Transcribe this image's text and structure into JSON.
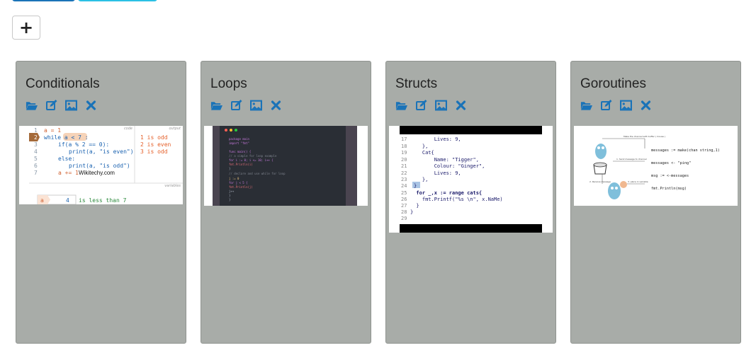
{
  "toolbar": {
    "add_label": "+"
  },
  "accent": "#1a73b8",
  "cards": [
    {
      "title": "Conditionals",
      "actions": [
        "folder-open-icon",
        "edit-icon",
        "image-icon",
        "close-icon"
      ],
      "thumb": {
        "header_code": "code",
        "header_output": "output",
        "code_lines": [
          {
            "n": "1",
            "t": "a = 1"
          },
          {
            "n": "2",
            "t": "while a < 7 :"
          },
          {
            "n": "3",
            "t": "if(a % 2 == 0):"
          },
          {
            "n": "4",
            "t": "print(a, \"is even\")"
          },
          {
            "n": "5",
            "t": "else:"
          },
          {
            "n": "6",
            "t": "print(a, \"is odd\")"
          },
          {
            "n": "7",
            "t": "a += 1"
          }
        ],
        "output_lines": [
          "1 is odd",
          "2 is even",
          "3 is odd"
        ],
        "watermark": "Wikitechy.com",
        "variables_label": "variables",
        "var_name": "a",
        "var_value": "4",
        "var_note": "is less than 7"
      }
    },
    {
      "title": "Loops",
      "actions": [
        "folder-open-icon",
        "edit-icon",
        "image-icon",
        "close-icon"
      ],
      "thumb": {
        "code_lines": [
          "package main",
          "import \"fmt\"",
          "",
          "func main() {",
          "  // a simple for loop example",
          "  for i := 0; i <= 10; i++ {",
          "    fmt.Println(i)",
          "  }",
          "  // declare and use while for loop",
          "  j := 0",
          "  for j < 5 {",
          "    fmt.Println(j)",
          "    j++",
          "  }",
          "}"
        ]
      }
    },
    {
      "title": "Structs",
      "actions": [
        "folder-open-icon",
        "edit-icon",
        "image-icon",
        "close-icon"
      ],
      "thumb": {
        "code_lines": [
          {
            "n": "17",
            "t": "        Lives: 9,"
          },
          {
            "n": "18",
            "t": "    },"
          },
          {
            "n": "19",
            "t": "    Cat{"
          },
          {
            "n": "20",
            "t": "        Name: \"Tigger\","
          },
          {
            "n": "21",
            "t": "        Colour: \"Ginger\","
          },
          {
            "n": "22",
            "t": "        Lives: 9,"
          },
          {
            "n": "23",
            "t": "    },"
          },
          {
            "n": "24",
            "t": "}"
          },
          {
            "n": "25",
            "t": "  for _,x := range cats{"
          },
          {
            "n": "26",
            "t": "    fmt.Printf(\"%s \\n\", x.NaMe)"
          },
          {
            "n": "27",
            "t": "  }"
          },
          {
            "n": "28",
            "t": "}"
          },
          {
            "n": "29",
            "t": ""
          }
        ]
      }
    },
    {
      "title": "Goroutines",
      "actions": [
        "folder-open-icon",
        "edit-icon",
        "image-icon",
        "close-icon"
      ],
      "thumb": {
        "code_lines": [
          "messages := make(chan string,1)",
          "messages <- \"ping\"",
          "msg := <-messages",
          "fmt.Println(msg)"
        ],
        "notes": [
          "Make the channel with buffer ( mouse )",
          "1. Send message to channel",
          "2. Receive message",
          "3. place in variable"
        ]
      }
    }
  ]
}
